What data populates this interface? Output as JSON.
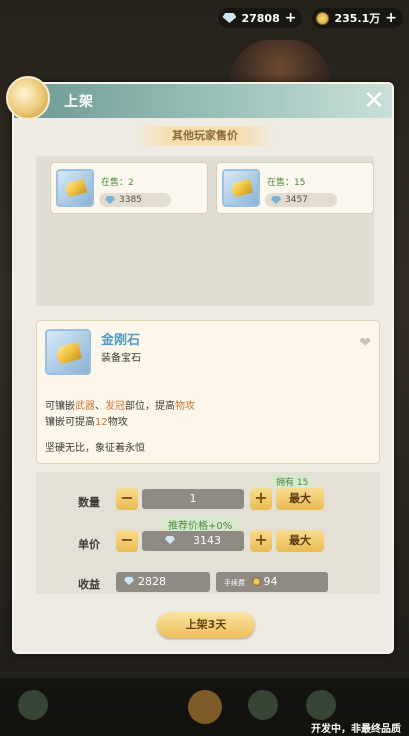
{
  "currency": {
    "gems": "27808",
    "coins": "235.1万"
  },
  "dialog": {
    "title": "上架"
  },
  "other_sellers": {
    "section_title": "其他玩家售价",
    "listings": [
      {
        "on_sale": "在售：2",
        "price": "3385"
      },
      {
        "on_sale": "在售：15",
        "price": "3457"
      }
    ]
  },
  "item": {
    "name": "金刚石",
    "type": "装备宝石",
    "desc_line1_a": "可镶嵌",
    "desc_line1_b": "武器",
    "desc_line1_c": "、",
    "desc_line1_d": "发冠",
    "desc_line1_e": "部位，提高",
    "desc_line1_f": "物攻",
    "desc_line2_a": "镶嵌可提高",
    "desc_line2_b": "12",
    "desc_line2_c": "物攻",
    "flavor": "坚硬无比，象征着永恒"
  },
  "form": {
    "owned": "拥有 15",
    "quantity_label": "数量",
    "quantity_value": "1",
    "max_label": "最大",
    "recommend": "推荐价格+0%",
    "price_label": "单价",
    "price_value": "3143",
    "revenue_label": "收益",
    "revenue_value": "2828",
    "fee_label": "手续费",
    "fee_value": "94",
    "minus": "−",
    "plus": "+"
  },
  "list_button": "上架3天",
  "watermark": "开发中，非最终品质"
}
